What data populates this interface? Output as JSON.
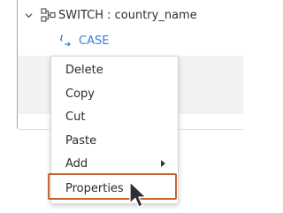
{
  "tree": {
    "switch_label": "SWITCH : country_name",
    "case_label": "CASE"
  },
  "context_menu": {
    "items": [
      {
        "label": "Delete"
      },
      {
        "label": "Copy"
      },
      {
        "label": "Cut"
      },
      {
        "label": "Paste"
      },
      {
        "label": "Add",
        "has_submenu": true
      },
      {
        "label": "Properties",
        "highlighted": true
      }
    ]
  },
  "colors": {
    "accent_blue": "#3d7bd6",
    "highlight_border": "#c0652d",
    "cursor": "#2b2f3a"
  },
  "icons": [
    "chevron-down-icon",
    "switch-node-icon",
    "case-braces-icon",
    "submenu-arrow-icon",
    "mouse-pointer-icon"
  ]
}
